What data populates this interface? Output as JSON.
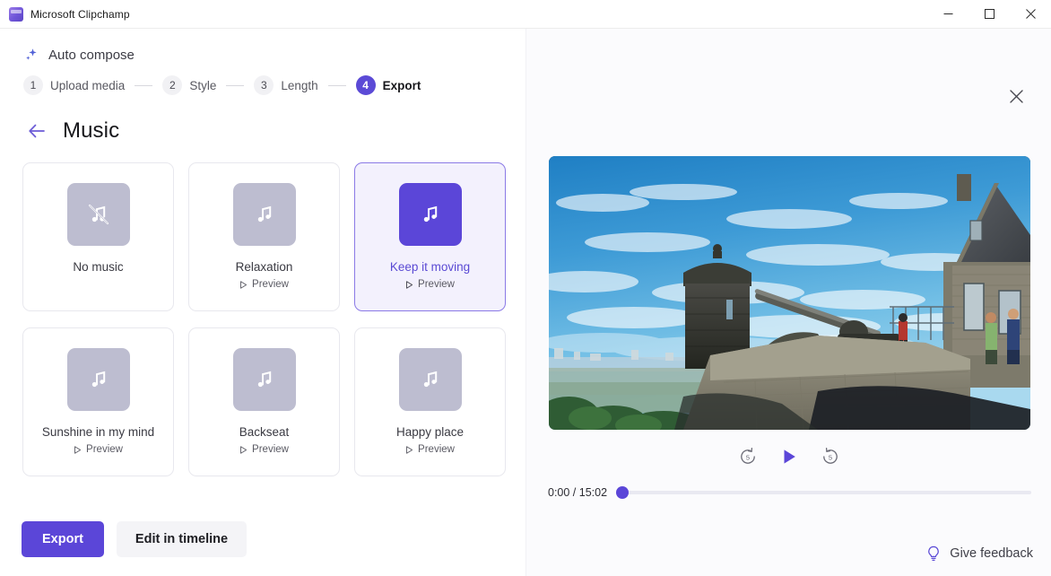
{
  "window": {
    "title": "Microsoft Clipchamp",
    "app_icon": "clipchamp-icon",
    "minimize_label": "Minimize",
    "maximize_label": "Maximize",
    "close_label": "Close"
  },
  "colors": {
    "accent": "#5b46d8",
    "accent_soft": "#f3f1fd",
    "thumb_grey": "#bdbdd0",
    "panel_bg": "#fbfbfd"
  },
  "auto_compose": {
    "label": "Auto compose",
    "icon": "sparkle-icon"
  },
  "stepper": {
    "steps": [
      {
        "number": "1",
        "label": "Upload media",
        "active": false
      },
      {
        "number": "2",
        "label": "Style",
        "active": false
      },
      {
        "number": "3",
        "label": "Length",
        "active": false
      },
      {
        "number": "4",
        "label": "Export",
        "active": true
      }
    ]
  },
  "section": {
    "back_icon": "arrow-left-icon",
    "title": "Music"
  },
  "music_cards": [
    {
      "title": "No music",
      "preview": null,
      "icon": "music-note-muted-icon",
      "selected": false
    },
    {
      "title": "Relaxation",
      "preview": "Preview",
      "icon": "music-note-icon",
      "selected": false
    },
    {
      "title": "Keep it moving",
      "preview": "Preview",
      "icon": "music-note-icon",
      "selected": true
    },
    {
      "title": "Sunshine in my mind",
      "preview": "Preview",
      "icon": "music-note-icon",
      "selected": false
    },
    {
      "title": "Backseat",
      "preview": "Preview",
      "icon": "music-note-icon",
      "selected": false
    },
    {
      "title": "Happy place",
      "preview": "Preview",
      "icon": "music-note-icon",
      "selected": false
    }
  ],
  "actions": {
    "export_label": "Export",
    "edit_timeline_label": "Edit in timeline"
  },
  "preview": {
    "close_icon": "close-icon",
    "video_alt": "Edinburgh Castle cannon overlooking the city",
    "controls": {
      "rewind_label": "5",
      "rewind_icon": "skip-back-5-icon",
      "play_icon": "play-icon",
      "forward_label": "5",
      "forward_icon": "skip-forward-5-icon"
    },
    "time_current": "0:00",
    "time_total": "15:02",
    "time_display": "0:00 / 15:02",
    "progress_percent": 0
  },
  "feedback": {
    "icon": "lightbulb-icon",
    "label": "Give feedback"
  }
}
